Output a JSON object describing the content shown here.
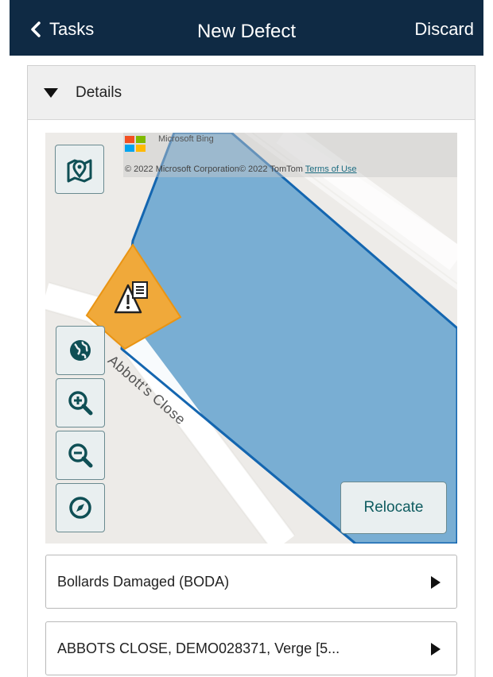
{
  "header": {
    "back_label": "Tasks",
    "title": "New Defect",
    "discard_label": "Discard",
    "background": "#0f2a44"
  },
  "panel": {
    "section_label": "Details",
    "expanded": true
  },
  "map": {
    "attribution_brand": "Microsoft Bing",
    "copyright_text": "© 2022 Microsoft Corporation© 2022 TomTom",
    "terms_link": "Terms of Use",
    "road_label": "Abbott's Close",
    "relocate_label": "Relocate",
    "polygon_fill": "#79aed3",
    "polygon_stroke": "#1466b0",
    "marker_fill": "#f0a93a",
    "controls": [
      "map-pin-icon",
      "globe-icon",
      "zoom-in-icon",
      "zoom-out-icon",
      "compass-icon"
    ]
  },
  "fields": {
    "defect_type": "Bollards Damaged (BODA)",
    "location": "ABBOTS CLOSE, DEMO028371, Verge [5..."
  }
}
